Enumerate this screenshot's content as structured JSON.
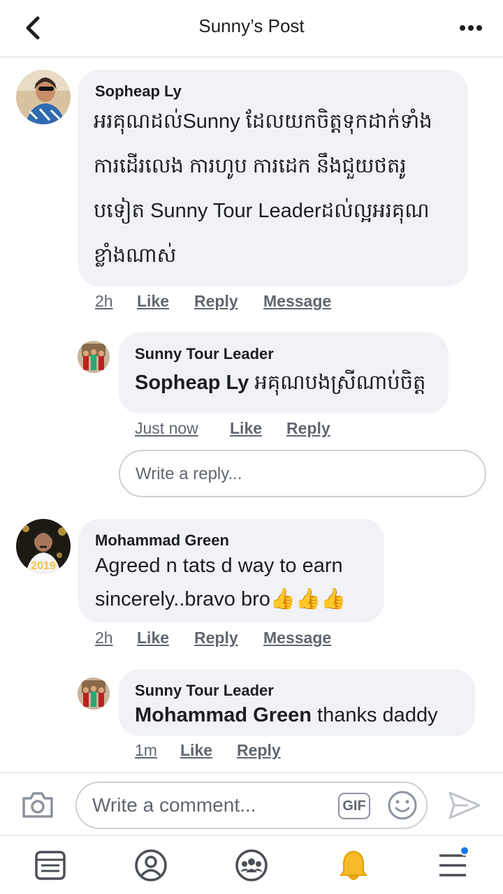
{
  "header": {
    "title": "Sunny’s Post"
  },
  "comments": [
    {
      "author": "Sopheap Ly",
      "lines": [
        "អរគុណដល់Sunny ដែលយកចិត្តទុកដាក់ទាំង",
        "ការដើរលេង ការហូប ការដេក នឹងជួយថតរូ",
        "បទៀត Sunny Tour Leaderដល់ល្អអរគុណ",
        "ខ្លាំងណាស់"
      ],
      "time": "2h",
      "like": "Like",
      "reply": "Reply",
      "message": "Message"
    },
    {
      "author": "Mohammad Green",
      "lines": [
        "Agreed n tats d way to earn",
        "sincerely..bravo bro👍👍👍"
      ],
      "time": "2h",
      "like": "Like",
      "reply": "Reply",
      "message": "Message"
    }
  ],
  "replies": [
    {
      "author": "Sunny Tour Leader",
      "mention": "Sopheap Ly",
      "text": " អគុណបងស្រីណាប់ចិត្ត",
      "time": "Just now",
      "like": "Like",
      "reply": "Reply"
    },
    {
      "author": "Sunny Tour Leader",
      "mention": "Mohammad Green",
      "text": " thanks daddy",
      "time": "1m",
      "like": "Like",
      "reply": "Reply"
    }
  ],
  "reply_input": {
    "placeholder": "Write a reply..."
  },
  "composer": {
    "placeholder": "Write a comment...",
    "gif_label": "GIF"
  },
  "nav": {
    "icons": [
      "news-feed-icon",
      "profile-icon",
      "groups-icon",
      "notifications-icon",
      "menu-icon"
    ],
    "notification_dot_color": "#1877f2",
    "bell_color": "#f7b928"
  }
}
